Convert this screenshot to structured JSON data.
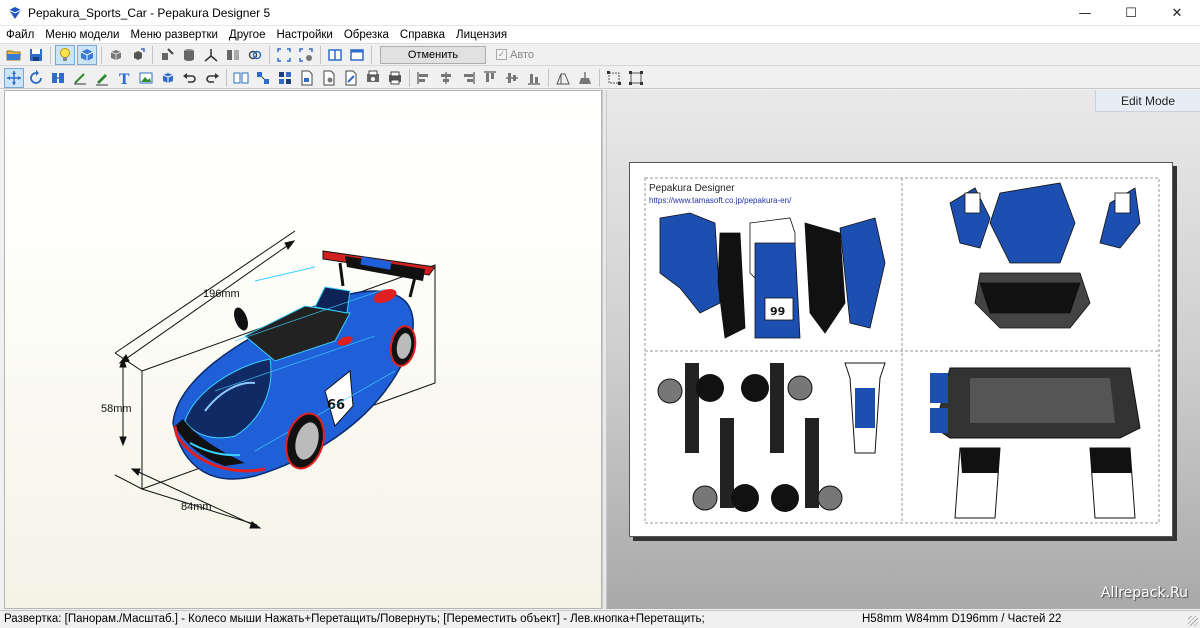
{
  "window": {
    "title": "Pepakura_Sports_Car - Pepakura Designer 5",
    "buttons": {
      "minimize": "—",
      "maximize": "☐",
      "close": "✕"
    }
  },
  "menu": [
    "Файл",
    "Меню модели",
    "Меню развертки",
    "Другое",
    "Настройки",
    "Обрезка",
    "Справка",
    "Лицензия"
  ],
  "toolbar": {
    "undo_label": "Отменить",
    "auto_label": "Авто"
  },
  "view3d": {
    "dim_length": "196mm",
    "dim_height": "58mm",
    "dim_width": "84mm"
  },
  "view2d": {
    "mode_label": "Edit Mode",
    "paper_title": "Pepakura Designer",
    "paper_url": "https://www.tamasoft.co.jp/pepakura-en/",
    "part_number": "99",
    "watermark": "Allrepack.Ru"
  },
  "car": {
    "number": "66"
  },
  "status": {
    "left": "Развертка: [Панорам./Масштаб.] - Колесо мыши Нажать+Перетащить/Повернуть; [Переместить объект] - Лев.кнопка+Перетащить;",
    "right": "H58mm W84mm D196mm / Частей 22"
  },
  "colors": {
    "accent": "#1a56c4",
    "body_blue": "#1f5fd8",
    "wireframe": "#3ad0ff",
    "edge_red": "#e02020"
  }
}
